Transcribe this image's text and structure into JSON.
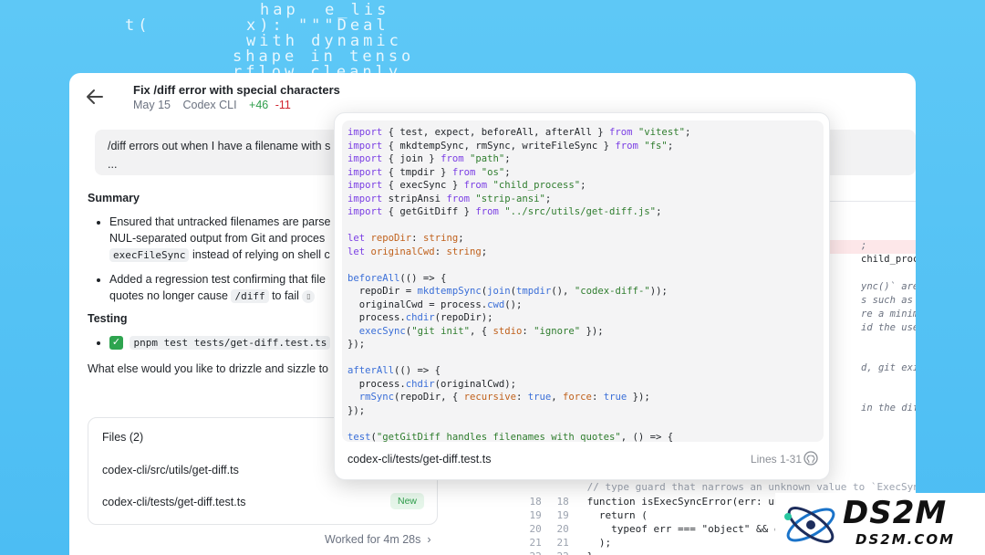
{
  "background_glyphs": [
    "hap  e_lis",
    "t(",
    "x): \"\"\"Deal",
    "with dynamic",
    "shape in tenso",
    "rflow cleanly"
  ],
  "header": {
    "title": "Fix /diff error with special characters",
    "date": "May 15",
    "source": "Codex CLI",
    "additions": "+46",
    "deletions": "-11"
  },
  "prompt": {
    "line1": "/diff errors out when I have a filename with s",
    "line2": "..."
  },
  "summary": {
    "heading": "Summary",
    "b1_a": "Ensured that untracked filenames are parse",
    "b1_b": "NUL-separated output from Git and proces",
    "b1_chip": "execFileSync",
    "b1_c": "instead of relying on shell c",
    "b2_a": "Added a regression test confirming that file",
    "b2_b": "quotes no longer cause",
    "b2_chip": "/diff",
    "b2_c": "to fail"
  },
  "testing": {
    "heading": "Testing",
    "command": "pnpm test tests/get-diff.test.ts"
  },
  "followup": "What else would you like to drizzle and sizzle to",
  "files": {
    "title": "Files (2)",
    "items": [
      {
        "path": "codex-cli/src/utils/get-diff.ts",
        "badge": ""
      },
      {
        "path": "codex-cli/tests/get-diff.test.ts",
        "badge": "New"
      }
    ]
  },
  "worked": "Worked for 4m 28s",
  "popover": {
    "file": "codex-cli/tests/get-diff.test.ts",
    "lines": "Lines 1-31",
    "code": [
      [
        [
          "kw",
          "import"
        ],
        [
          "",
          "{ test, expect, beforeAll, afterAll } "
        ],
        [
          "kw",
          "from"
        ],
        [
          "str",
          " \"vitest\""
        ],
        [
          "",
          ";"
        ]
      ],
      [
        [
          "kw",
          "import"
        ],
        [
          "",
          "{ mkdtempSync, rmSync, writeFileSync } "
        ],
        [
          "kw",
          "from"
        ],
        [
          "str",
          " \"fs\""
        ],
        [
          "",
          ";"
        ]
      ],
      [
        [
          "kw",
          "import"
        ],
        [
          "",
          "{ join } "
        ],
        [
          "kw",
          "from"
        ],
        [
          "str",
          " \"path\""
        ],
        [
          "",
          ";"
        ]
      ],
      [
        [
          "kw",
          "import"
        ],
        [
          "",
          "{ tmpdir } "
        ],
        [
          "kw",
          "from"
        ],
        [
          "str",
          " \"os\""
        ],
        [
          "",
          ";"
        ]
      ],
      [
        [
          "kw",
          "import"
        ],
        [
          "",
          "{ execSync } "
        ],
        [
          "kw",
          "from"
        ],
        [
          "str",
          " \"child_process\""
        ],
        [
          "",
          ";"
        ]
      ],
      [
        [
          "kw",
          "import"
        ],
        [
          "",
          "stripAnsi "
        ],
        [
          "kw",
          "from"
        ],
        [
          "str",
          " \"strip-ansi\""
        ],
        [
          "",
          ";"
        ]
      ],
      [
        [
          "kw",
          "import"
        ],
        [
          "",
          "{ getGitDiff } "
        ],
        [
          "kw",
          "from"
        ],
        [
          "str",
          " \"../src/utils/get-diff.js\""
        ],
        [
          "",
          ";"
        ]
      ],
      [],
      [
        [
          "kw",
          "let "
        ],
        [
          "ty",
          "repoDir"
        ],
        [
          "",
          ": "
        ],
        [
          "ty",
          "string"
        ],
        [
          "",
          ";"
        ]
      ],
      [
        [
          "kw",
          "let "
        ],
        [
          "ty",
          "originalCwd"
        ],
        [
          "",
          ": "
        ],
        [
          "ty",
          "string"
        ],
        [
          "",
          ";"
        ]
      ],
      [],
      [
        [
          "fn",
          "beforeAll"
        ],
        [
          "",
          "(() => {"
        ]
      ],
      [
        [
          "",
          "  repoDir = "
        ],
        [
          "fn",
          "mkdtempSync"
        ],
        [
          "",
          "("
        ],
        [
          "fn",
          "join"
        ],
        [
          "",
          "("
        ],
        [
          "fn",
          "tmpdir"
        ],
        [
          "",
          "(), "
        ],
        [
          "str",
          "\"codex-diff-\""
        ],
        [
          "",
          "));"
        ]
      ],
      [
        [
          "",
          "  originalCwd = process."
        ],
        [
          "fn",
          "cwd"
        ],
        [
          "",
          "();"
        ]
      ],
      [
        [
          "",
          "  process."
        ],
        [
          "fn",
          "chdir"
        ],
        [
          "",
          "(repoDir);"
        ]
      ],
      [
        [
          "",
          "  "
        ],
        [
          "fn",
          "execSync"
        ],
        [
          "",
          "("
        ],
        [
          "str",
          "\"git init\""
        ],
        [
          "",
          ", { "
        ],
        [
          "ty",
          "stdio"
        ],
        [
          "",
          ": "
        ],
        [
          "str",
          "\"ignore\""
        ],
        [
          "",
          " });"
        ]
      ],
      [
        [
          "",
          "});"
        ]
      ],
      [],
      [
        [
          "fn",
          "afterAll"
        ],
        [
          "",
          "(() => {"
        ]
      ],
      [
        [
          "",
          "  process."
        ],
        [
          "fn",
          "chdir"
        ],
        [
          "",
          "(originalCwd);"
        ]
      ],
      [
        [
          "",
          "  "
        ],
        [
          "fn",
          "rmSync"
        ],
        [
          "",
          "(repoDir, { "
        ],
        [
          "ty",
          "recursive"
        ],
        [
          "",
          ": "
        ],
        [
          "fn",
          "true"
        ],
        [
          "",
          ", "
        ],
        [
          "ty",
          "force"
        ],
        [
          "",
          ": "
        ],
        [
          "fn",
          "true"
        ],
        [
          "",
          " });"
        ]
      ],
      [
        [
          "",
          "});"
        ]
      ],
      [],
      [
        [
          "fn",
          "test"
        ],
        [
          "",
          "("
        ],
        [
          "str",
          "\"getGitDiff handles filenames with quotes\""
        ],
        [
          "",
          ", () => {"
        ]
      ]
    ]
  },
  "diff": {
    "fragments": [
      ";",
      "child_process\";",
      "ync()` are `Err",
      "s such as `stat",
      "re a minimal in",
      "id the use of `",
      "d, git exits wi",
      "in the diff out"
    ],
    "bottom_lines": [
      {
        "old": "",
        "new": "",
        "text": "// type guard that narrows an unknown value to `ExecSyncError"
      },
      {
        "old": "",
        "new": "",
        "text": "function isExecSyncError(err: unknown): err is ExecSyncError"
      },
      {
        "old": "19",
        "new": "19",
        "text": "  return ("
      },
      {
        "old": "20",
        "new": "20",
        "text": "    typeof err === \"object\" && err"
      },
      {
        "old": "21",
        "new": "21",
        "text": "  );"
      },
      {
        "old": "22",
        "new": "22",
        "text": "}"
      }
    ],
    "partial_numbers": [
      "18",
      "18"
    ]
  },
  "logo": {
    "main": "DS2M",
    "sub": "DS2M.COM"
  },
  "colors": {
    "accent_green": "#2e9e4b",
    "accent_red": "#d1242f",
    "bg_blue": "#4cbdf3"
  }
}
